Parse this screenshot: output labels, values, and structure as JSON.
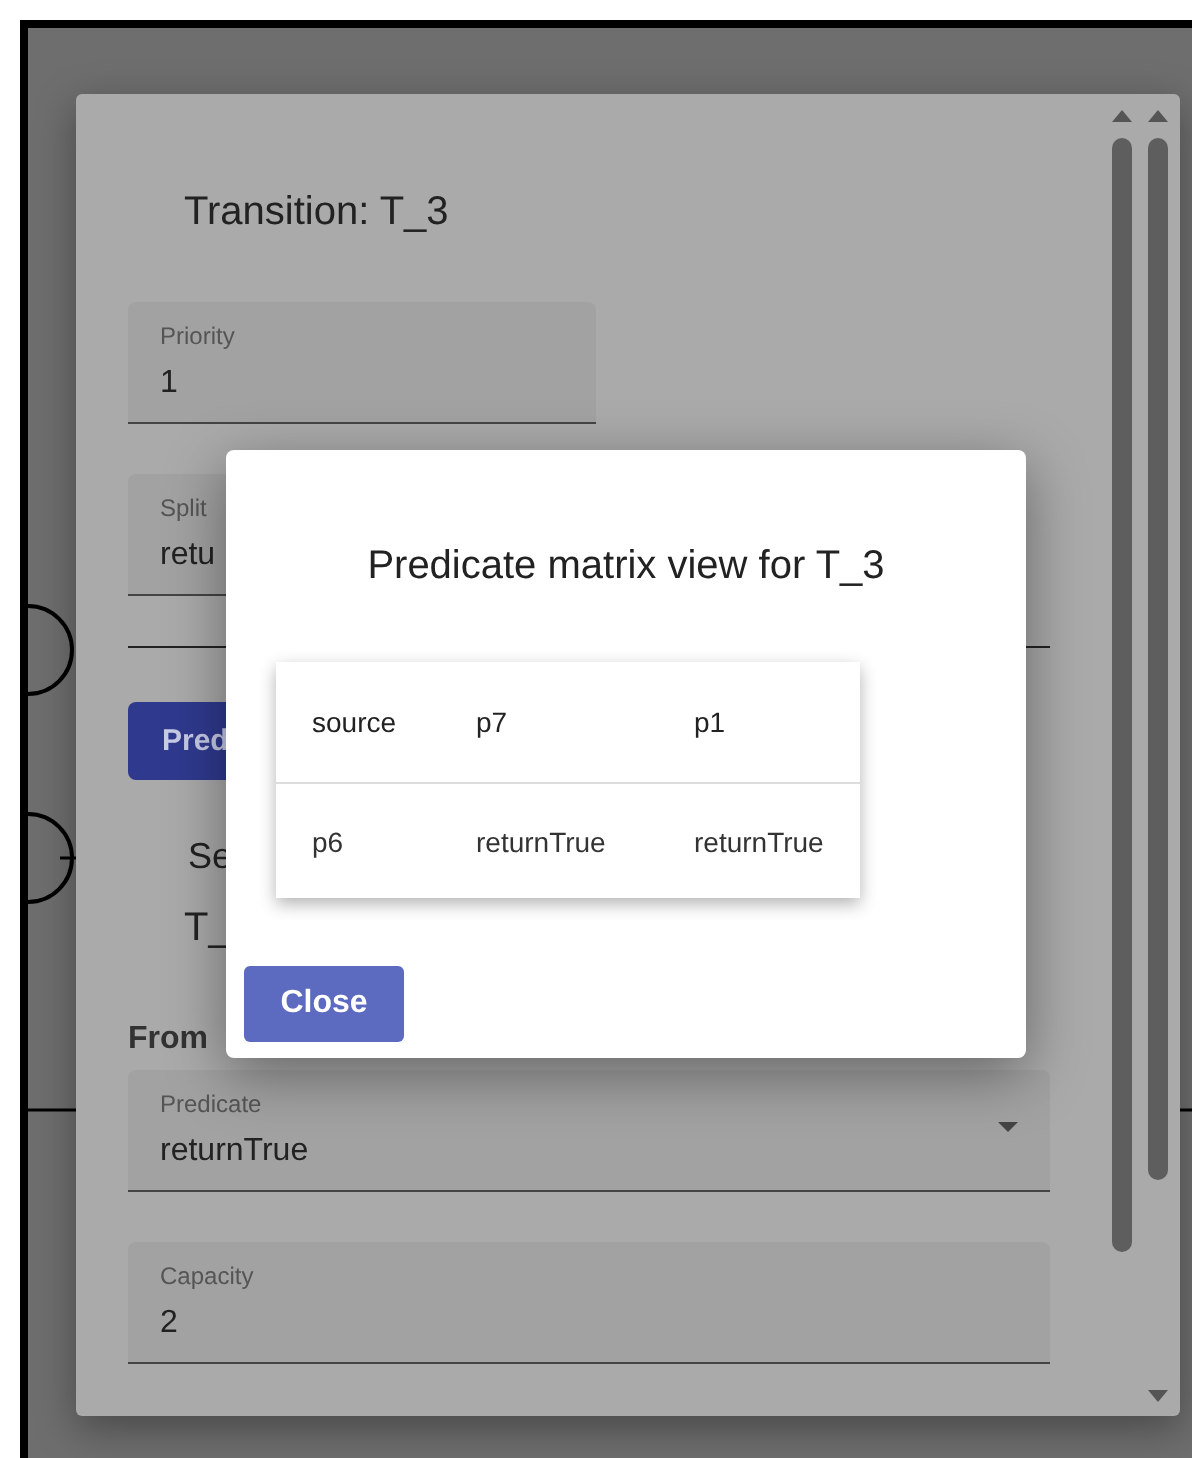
{
  "background_panel": {
    "title": "Transition: T_3",
    "fields": [
      {
        "kind": "text",
        "label": "Priority",
        "value": "1"
      },
      {
        "kind": "text",
        "label": "Split",
        "value": "retu"
      }
    ],
    "button": "Pred",
    "section_title": "Se",
    "section_value": "T_",
    "from_heading": "From",
    "lower_fields": [
      {
        "kind": "select",
        "label": "Predicate",
        "value": "returnTrue"
      },
      {
        "kind": "text",
        "label": "Capacity",
        "value": "2"
      }
    ]
  },
  "dialog": {
    "title": "Predicate matrix view for T_3",
    "table": {
      "columns": [
        "source",
        "p7",
        "p1"
      ],
      "rows": [
        [
          "p6",
          "returnTrue",
          "returnTrue"
        ]
      ]
    },
    "buttons": [
      "Close"
    ]
  }
}
